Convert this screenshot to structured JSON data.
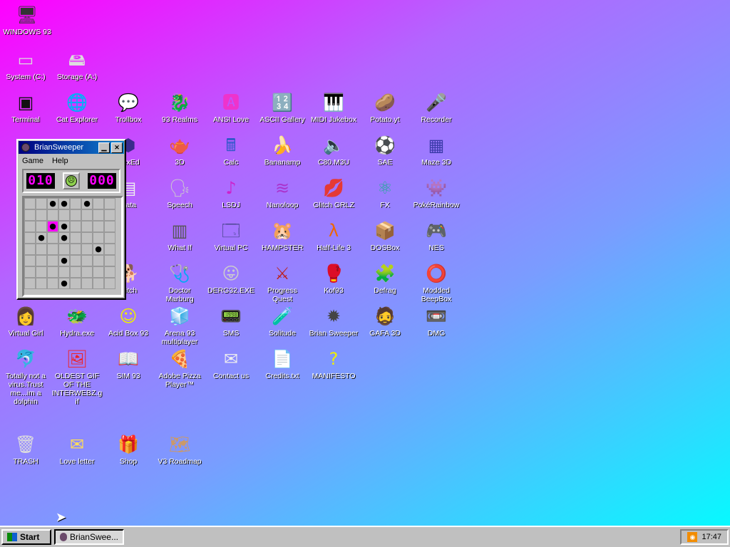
{
  "desktop_icons": [
    {
      "label": "WINDOWS 93",
      "icon": "computer-icon",
      "glyph": "🖥"
    },
    {
      "label": "System (C:)",
      "icon": "drive-icon",
      "glyph": "▭"
    },
    {
      "label": "Storage (A:)",
      "icon": "floppy-drive-icon",
      "glyph": "🖴"
    },
    {
      "label": "Terminal",
      "icon": "terminal-icon",
      "glyph": "▣"
    },
    {
      "label": "Cat Explorer",
      "icon": "cat-globe-icon",
      "glyph": "🌐"
    },
    {
      "label": "Trollbox",
      "icon": "chat-icon",
      "glyph": "💬"
    },
    {
      "label": "93 Realms",
      "icon": "realms-icon",
      "glyph": "🐉"
    },
    {
      "label": "ANSI Love",
      "icon": "ansi-icon",
      "glyph": "🅰"
    },
    {
      "label": "ASCII Gallery",
      "icon": "ascii-icon",
      "glyph": "🔢"
    },
    {
      "label": "MIDI Jukebox",
      "icon": "piano-icon",
      "glyph": "🎹"
    },
    {
      "label": "Potato.yt",
      "icon": "potato-icon",
      "glyph": "🥔"
    },
    {
      "label": "Recorder",
      "icon": "microphone-icon",
      "glyph": "🎤"
    },
    {
      "label": "HexEd",
      "icon": "hexed-icon",
      "glyph": "⬢"
    },
    {
      "label": "3D",
      "icon": "teapot-icon",
      "glyph": "🫖"
    },
    {
      "label": "Calc",
      "icon": "calculator-icon",
      "glyph": "🖩"
    },
    {
      "label": "Bananamp",
      "icon": "banana-icon",
      "glyph": "🍌"
    },
    {
      "label": "C80.M3U",
      "icon": "playlist-icon",
      "glyph": "🔈"
    },
    {
      "label": "SAE",
      "icon": "sae-ball-icon",
      "glyph": "⚽"
    },
    {
      "label": "Maze 3D",
      "icon": "maze-icon",
      "glyph": "▦"
    },
    {
      "label": "Data",
      "icon": "data-icon",
      "glyph": "▤"
    },
    {
      "label": "Speech",
      "icon": "speech-icon",
      "glyph": "🗣"
    },
    {
      "label": "LSDJ",
      "icon": "lsdj-icon",
      "glyph": "♪"
    },
    {
      "label": "Nanoloop",
      "icon": "nanoloop-icon",
      "glyph": "≋"
    },
    {
      "label": "Glitch GRLZ",
      "icon": "lips-icon",
      "glyph": "💋"
    },
    {
      "label": "FX",
      "icon": "atom-icon",
      "glyph": "⚛"
    },
    {
      "label": "PokéRainbow",
      "icon": "pokerainbow-icon",
      "glyph": "👾"
    },
    {
      "label": "What If",
      "icon": "whatif-icon",
      "glyph": "▥"
    },
    {
      "label": "Virtual PC",
      "icon": "virtual-pc-icon",
      "glyph": "🗔"
    },
    {
      "label": "HAMPSTER",
      "icon": "hamster-icon",
      "glyph": "🐹"
    },
    {
      "label": "Half-Life 3",
      "icon": "half-life-icon",
      "glyph": "λ"
    },
    {
      "label": "DOSBox",
      "icon": "dosbox-icon",
      "glyph": "📦"
    },
    {
      "label": "NES",
      "icon": "nes-icon",
      "glyph": "🎮"
    },
    {
      "label": "glitch",
      "icon": "corgi-icon",
      "glyph": "🐕"
    },
    {
      "label": "Doctor Marburg",
      "icon": "doctor-icon",
      "glyph": "🩺"
    },
    {
      "label": "DERG32.EXE",
      "icon": "derg-icon",
      "glyph": "😛"
    },
    {
      "label": "Progress Quest",
      "icon": "swords-icon",
      "glyph": "⚔"
    },
    {
      "label": "Kof93",
      "icon": "fighter-icon",
      "glyph": "🥊"
    },
    {
      "label": "Defrag",
      "icon": "defrag-icon",
      "glyph": "🧩"
    },
    {
      "label": "Modded BeepBox",
      "icon": "beepbox-icon",
      "glyph": "⭕"
    },
    {
      "label": "Virtual Girl",
      "icon": "virtual-girl-icon",
      "glyph": "👩"
    },
    {
      "label": "Hydra.exe",
      "icon": "hydra-icon",
      "glyph": "🐲"
    },
    {
      "label": "Acid Box 93",
      "icon": "smiley-icon",
      "glyph": "☺"
    },
    {
      "label": "Arena 93 multiplayer",
      "icon": "cube-icon",
      "glyph": "🧊"
    },
    {
      "label": "SMS",
      "icon": "sms-icon",
      "glyph": "📟"
    },
    {
      "label": "Solitude",
      "icon": "solitude-icon",
      "glyph": "🧪"
    },
    {
      "label": "Brian Sweeper",
      "icon": "mine-icon",
      "glyph": "✹"
    },
    {
      "label": "GAFA 3D",
      "icon": "face-3d-icon",
      "glyph": "🧔"
    },
    {
      "label": "DMG",
      "icon": "dmg-icon",
      "glyph": "📼"
    },
    {
      "label": "Totally not a virus.Trust me...im a dolphin",
      "icon": "dolphin-icon",
      "glyph": "🐬"
    },
    {
      "label": "OLDEST GIF OF THE INTERWEBZ.gif",
      "icon": "gif-icon",
      "glyph": "🖼"
    },
    {
      "label": "SIM 93",
      "icon": "sim-icon",
      "glyph": "📖"
    },
    {
      "label": "Adobe Pizza Player™",
      "icon": "pizza-icon",
      "glyph": "🍕"
    },
    {
      "label": "Contact us",
      "icon": "contact-icon",
      "glyph": "✉"
    },
    {
      "label": "Credits.txt",
      "icon": "text-file-icon",
      "glyph": "📄"
    },
    {
      "label": "MANIFESTO",
      "icon": "question-icon",
      "glyph": "?"
    },
    {
      "label": "TRASH",
      "icon": "trash-icon",
      "glyph": "🗑"
    },
    {
      "label": "Love letter",
      "icon": "envelope-icon",
      "glyph": "✉"
    },
    {
      "label": "Shop",
      "icon": "gift-icon",
      "glyph": "🎁"
    },
    {
      "label": "V3 Roadmap",
      "icon": "map-icon",
      "glyph": "🗺"
    }
  ],
  "window": {
    "title": "BrianSweeper",
    "minimize_glyph": "▁",
    "close_glyph": "✕",
    "menu": [
      "Game",
      "Help"
    ],
    "mines_left": "010",
    "timer": "000",
    "face": "☹",
    "board": [
      [
        0,
        0,
        1,
        1,
        0,
        1,
        0,
        0
      ],
      [
        0,
        0,
        0,
        0,
        0,
        0,
        0,
        0
      ],
      [
        0,
        0,
        2,
        1,
        0,
        0,
        0,
        0
      ],
      [
        0,
        1,
        0,
        1,
        0,
        0,
        0,
        0
      ],
      [
        0,
        0,
        0,
        0,
        0,
        0,
        1,
        0
      ],
      [
        0,
        0,
        0,
        1,
        0,
        0,
        0,
        0
      ],
      [
        0,
        0,
        0,
        0,
        0,
        0,
        0,
        0
      ],
      [
        0,
        0,
        0,
        1,
        0,
        0,
        0,
        0
      ]
    ]
  },
  "taskbar": {
    "start_label": "Start",
    "task_label": "BrianSwee...",
    "clock": "17:47"
  }
}
